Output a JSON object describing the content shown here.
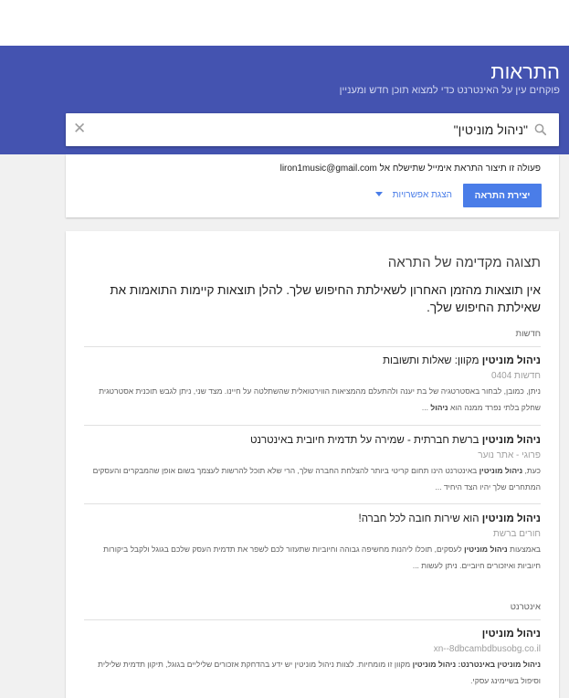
{
  "header": {
    "title": "התראות",
    "subtitle": "פוקחים עין על האינטרנט כדי למצוא תוכן חדש ומעניין"
  },
  "search": {
    "query": "\"ניהול מוניטין\"",
    "search_icon": "search-icon",
    "clear_icon": "close-icon"
  },
  "alert_card": {
    "info": "פעולה זו תיצור התראת אימייל שתישלח אל liron1music@gmail.com",
    "create_label": "יצירת התראה",
    "options_label": "הצגת אפשרויות",
    "accent": "#4a7de8"
  },
  "preview": {
    "title": "תצוגה מקדימה של התראה",
    "no_results": "אין תוצאות מהזמן האחרון לשאילתת החיפוש שלך. להלן תוצאות קיימות התואמות את שאילתת החיפוש שלך.",
    "sections": [
      {
        "label": "חדשות",
        "results": [
          {
            "title_bold": "ניהול מוניטין",
            "title_rest": " מקוון: שאלות ותשובות",
            "source": "חדשות 0404",
            "snippet_pre": "ניתן, כמובן, לבחור באסטרטגיה של בת יענה ולהתעלם מהמציאות הווירטואלית שהשתלטה על חיינו. מצד שני, ניתן לגבש תוכנית אסטרטגית שחלק בלתי נפרד ממנה הוא ",
            "snippet_bold": "ניהול",
            "snippet_post": " ..."
          },
          {
            "title_bold": "ניהול מוניטין",
            "title_rest": " ברשת חברתית - שמירה על תדמית חיובית באינטרנט",
            "source": "פרוגי - אתר נוער",
            "snippet_pre": "כעת, ",
            "snippet_bold": "ניהול מוניטין",
            "snippet_post": " באינטרנט הינו תחום קריטי ביותר להצלחת החברה שלך, הרי שלא תוכל להרשות לעצמך בשום אופן שהמבקרים והעסקים המתחרים שלך יהיו הצד היחיד ..."
          },
          {
            "title_bold": "ניהול מוניטין",
            "title_rest": " הוא שירות חובה לכל חברה!",
            "source": "חורים ברשת",
            "snippet_pre": "באמצעות ",
            "snippet_bold": "ניהול מוניטין",
            "snippet_post": " לעסקים, תוכלו ליהנות מחשיפה גבוהה וחיוביות שתעזור לכם לשפר את תדמית העסק שלכם בגוגל ולקבל ביקורות חיוביות ואיזכורים חיוביים. ניתן לעשות ..."
          }
        ]
      },
      {
        "label": "אינטרנט",
        "results": [
          {
            "title_bold": "ניהול מוניטין",
            "title_rest": "",
            "source": "xn--8dbcambdbusobg.co.il",
            "snippet_pre": "ניהול מוניטין",
            "snippet_bold": " באינטרנט: ניהול מוניטין",
            "snippet_post": " מקוון זו מומחיות. לצוות ניהול מוניטין יש ידע בהדחקת אזכורים שליליים בגוגל, תיקון תדמית שלילית וסיפול בשיימינג עסקי."
          }
        ]
      }
    ]
  }
}
